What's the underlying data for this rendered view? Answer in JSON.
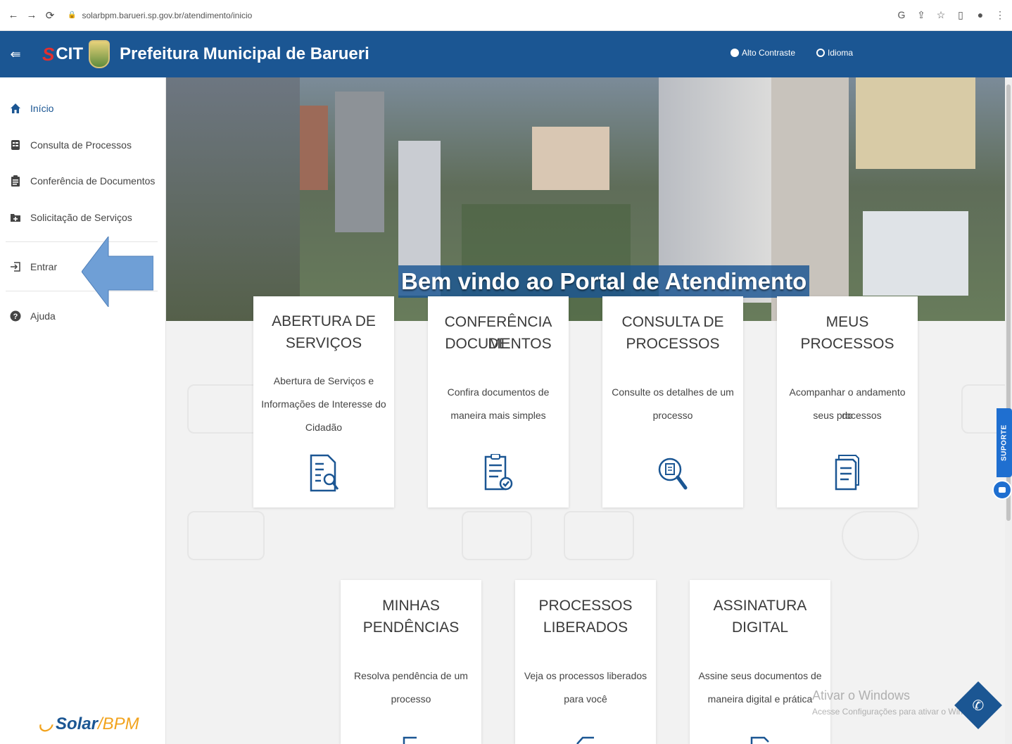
{
  "browser": {
    "url": "solarbpm.barueri.sp.gov.br/atendimento/inicio",
    "back_icon": "arrow-left-icon",
    "forward_icon": "arrow-right-icon",
    "reload_icon": "reload-icon"
  },
  "header": {
    "logo_text": "CIT",
    "title": "Prefeitura Municipal de Barueri",
    "contrast_label": "Alto Contraste",
    "language_label": "Idioma"
  },
  "sidebar": {
    "items": [
      {
        "label": "Início",
        "icon": "home-icon",
        "active": true
      },
      {
        "label": "Consulta de Processos",
        "icon": "list-icon"
      },
      {
        "label": "Conferência de Documentos",
        "icon": "clipboard-icon"
      },
      {
        "label": "Solicitação de Serviços",
        "icon": "folder-plus-icon"
      },
      {
        "label": "Entrar",
        "icon": "login-icon"
      },
      {
        "label": "Ajuda",
        "icon": "help-icon"
      }
    ],
    "footer_logo_main": "Solar",
    "footer_logo_sep": "/",
    "footer_logo_accent": "BPM"
  },
  "hero": {
    "title": "Bem vindo ao Portal de Atendimento"
  },
  "cards": [
    {
      "title_1": "ABERTURA DE",
      "title_2": "SERVIÇOS",
      "desc_1": "Abertura de Serviços e",
      "desc_2": "Informações de Interesse do",
      "desc_3": "Cidadão",
      "icon": "document-search-icon"
    },
    {
      "title_1": "CONFERÊNCIA DE",
      "title_2": "DOCUMENTOS",
      "desc_1": "Confira documentos de",
      "desc_2": "maneira mais simples",
      "icon": "document-check-icon"
    },
    {
      "title_1": "CONSULTA DE",
      "title_2": "PROCESSOS",
      "desc_1": "Consulte os detalhes de um",
      "desc_2": "processo",
      "icon": "magnifier-document-icon"
    },
    {
      "title_1": "MEUS",
      "title_2": "PROCESSOS",
      "desc_1": "Acompanhar o andamento do",
      "desc_2": "seus processos",
      "icon": "documents-icon"
    },
    {
      "title_1": "MINHAS",
      "title_2": "PENDÊNCIAS",
      "desc_1": "Resolva pendência de um",
      "desc_2": "processo",
      "icon": "pending-icon"
    },
    {
      "title_1": "PROCESSOS",
      "title_2": "LIBERADOS",
      "desc_1": "Veja os processos liberados",
      "desc_2": "para você",
      "icon": "released-icon"
    },
    {
      "title_1": "ASSINATURA",
      "title_2": "DIGITAL",
      "desc_1": "Assine seus documentos de",
      "desc_2": "maneira digital e prática",
      "icon": "signature-icon"
    }
  ],
  "support": {
    "label": "SUPORTE"
  },
  "windows_watermark": {
    "line1": "Ativar o Windows",
    "line2": "Acesse Configurações para ativar o Windows."
  },
  "colors": {
    "header_blue": "#1b5693",
    "support_blue": "#1f6fd0",
    "solar_orange": "#f2a31d"
  }
}
